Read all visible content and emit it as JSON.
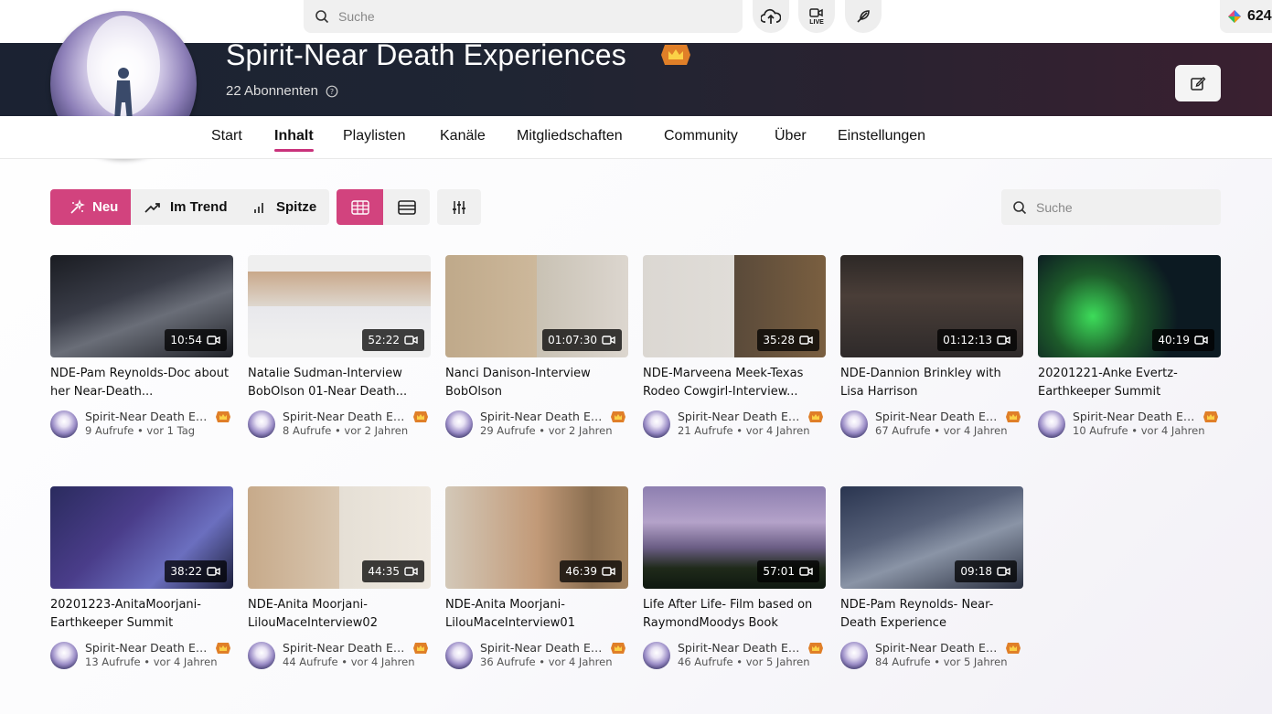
{
  "topbar": {
    "search_placeholder": "Suche",
    "upload_icon": "upload-cloud-icon",
    "live_label": "LIVE",
    "points_value": "624"
  },
  "channel": {
    "title": "Spirit-Near Death Experiences",
    "subscribers": "22 Abonnenten",
    "badge_icon": "crown-icon",
    "edit_icon": "edit-icon"
  },
  "nav": {
    "items": [
      {
        "label": "Start"
      },
      {
        "label": "Inhalt"
      },
      {
        "label": "Playlisten"
      },
      {
        "label": "Kanäle"
      },
      {
        "label": "Mitgliedschaften"
      },
      {
        "label": "Community"
      },
      {
        "label": "Über"
      },
      {
        "label": "Einstellungen"
      }
    ],
    "active": "Inhalt"
  },
  "filters": {
    "new": "Neu",
    "trend": "Im Trend",
    "top": "Spitze",
    "search_placeholder": "Suche"
  },
  "colors": {
    "accent": "#d2437e",
    "underline": "#c9317b"
  },
  "videos": [
    {
      "title": "NDE-Pam Reynolds-Doc about her Near-Death...",
      "duration": "10:54",
      "channel": "Spirit-Near Death Ex...",
      "meta": "9 Aufrufe • vor 1 Tag"
    },
    {
      "title": "Natalie Sudman-Interview BobOlson 01-Near Death...",
      "duration": "52:22",
      "channel": "Spirit-Near Death Ex...",
      "meta": "8 Aufrufe • vor 2 Jahren"
    },
    {
      "title": "Nanci Danison-Interview BobOlson",
      "duration": "01:07:30",
      "channel": "Spirit-Near Death Ex...",
      "meta": "29 Aufrufe • vor 2 Jahren"
    },
    {
      "title": "NDE-Marveena Meek-Texas Rodeo Cowgirl-Interview...",
      "duration": "35:28",
      "channel": "Spirit-Near Death Ex...",
      "meta": "21 Aufrufe • vor 4 Jahren"
    },
    {
      "title": "NDE-Dannion Brinkley with Lisa Harrison",
      "duration": "01:12:13",
      "channel": "Spirit-Near Death Ex...",
      "meta": "67 Aufrufe • vor 4 Jahren"
    },
    {
      "title": "20201221-Anke Evertz-Earthkeeper Summit",
      "duration": "40:19",
      "channel": "Spirit-Near Death Ex...",
      "meta": "10 Aufrufe • vor 4 Jahren"
    },
    {
      "title": "20201223-AnitaMoorjani-Earthkeeper Summit",
      "duration": "38:22",
      "channel": "Spirit-Near Death Ex...",
      "meta": "13 Aufrufe • vor 4 Jahren"
    },
    {
      "title": "NDE-Anita Moorjani-LilouMaceInterview02",
      "duration": "44:35",
      "channel": "Spirit-Near Death Ex...",
      "meta": "44 Aufrufe • vor 4 Jahren"
    },
    {
      "title": "NDE-Anita Moorjani-LilouMaceInterview01",
      "duration": "46:39",
      "channel": "Spirit-Near Death Ex...",
      "meta": "36 Aufrufe • vor 4 Jahren"
    },
    {
      "title": "Life After Life- Film based on RaymondMoodys Book",
      "duration": "57:01",
      "channel": "Spirit-Near Death Ex...",
      "meta": "46 Aufrufe • vor 5 Jahren"
    },
    {
      "title": "NDE-Pam Reynolds- Near-Death Experience",
      "duration": "09:18",
      "channel": "Spirit-Near Death Ex...",
      "meta": "84 Aufrufe • vor 5 Jahren"
    }
  ]
}
